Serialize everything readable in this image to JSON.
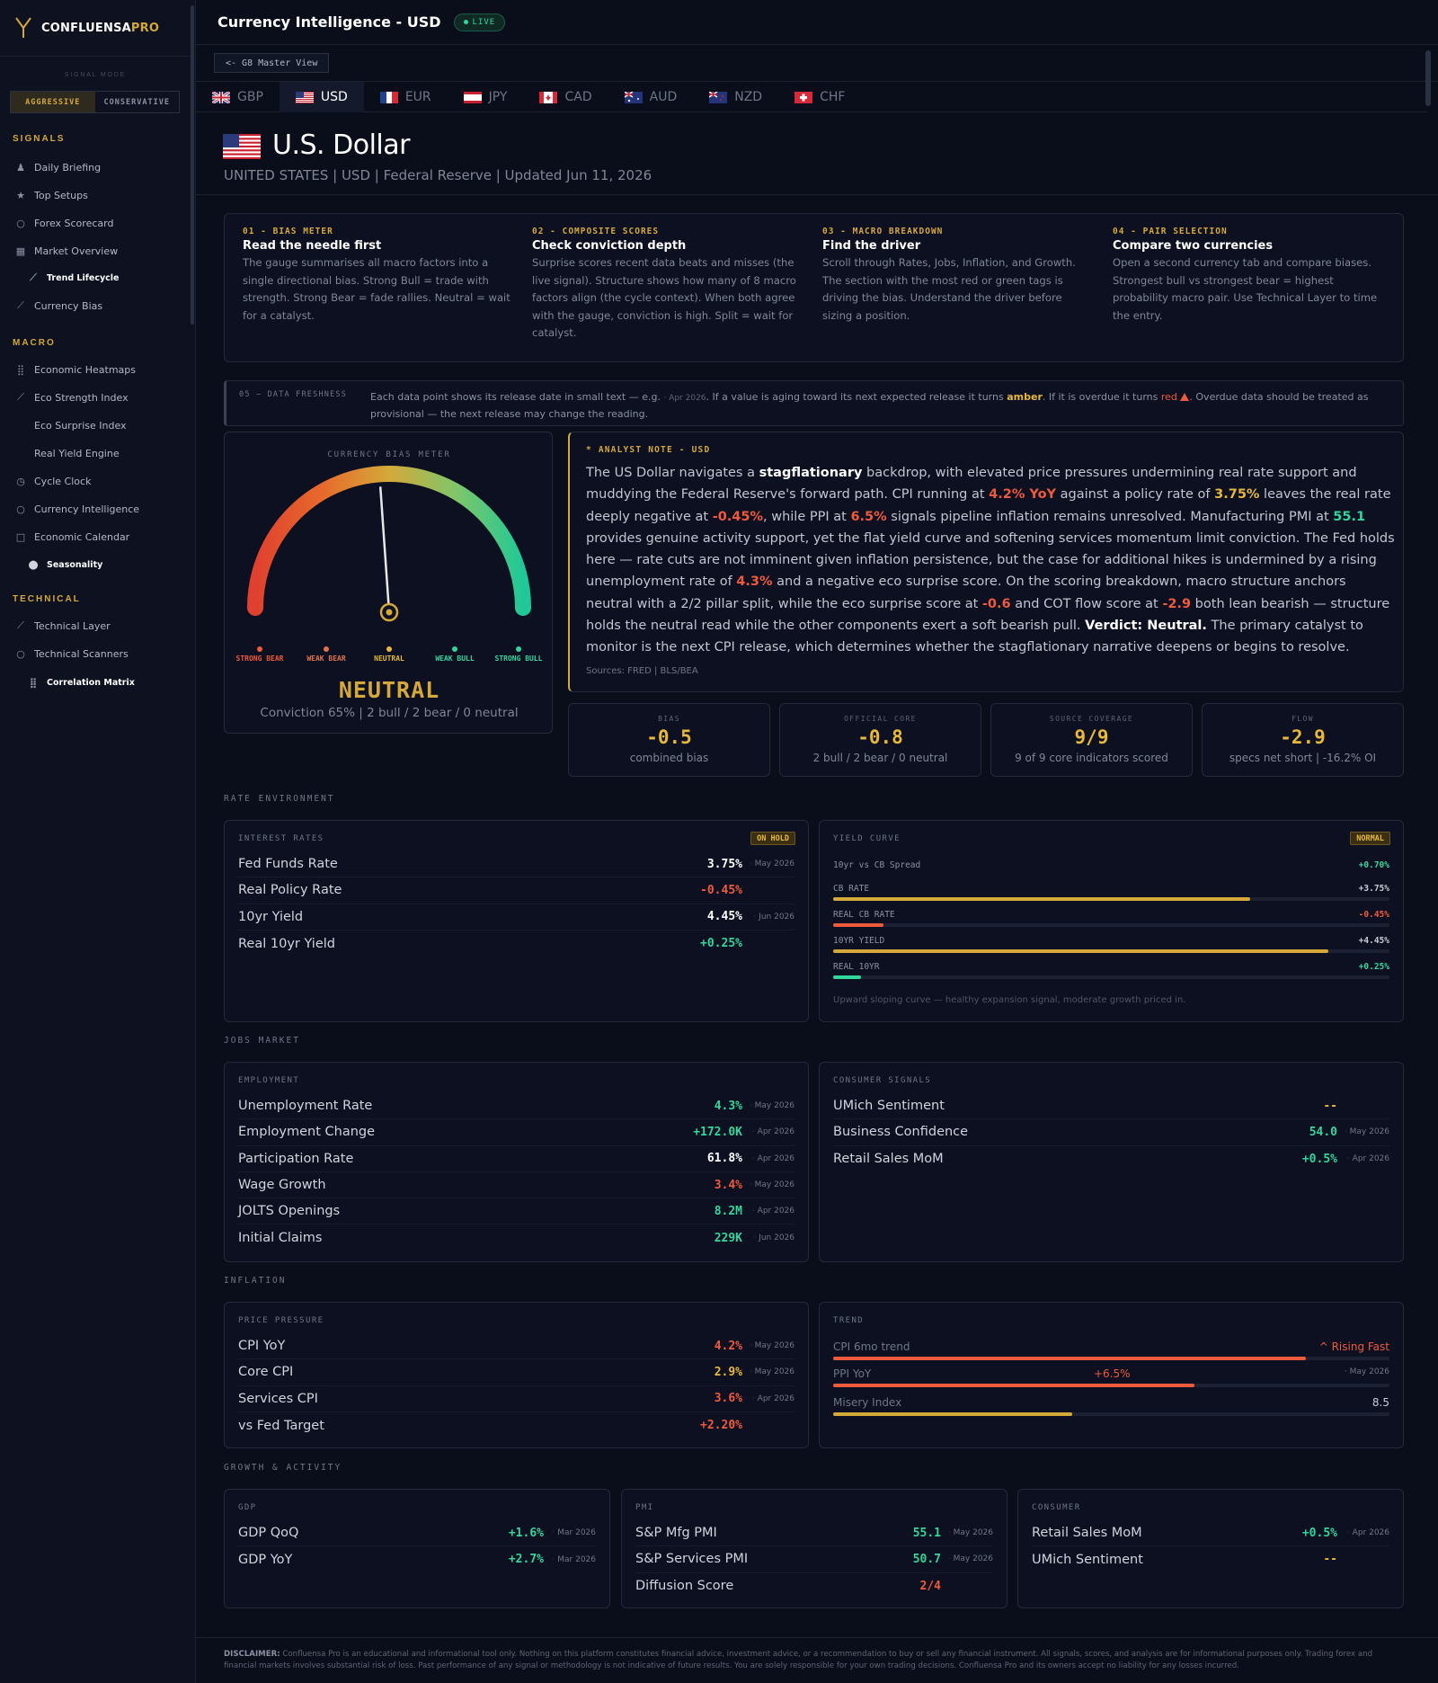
{
  "brand": {
    "name_main": "CONFLUENSA",
    "name_accent": "PRO"
  },
  "signal_mode": {
    "label": "SIGNAL MODE",
    "options": [
      "AGGRESSIVE",
      "CONSERVATIVE"
    ],
    "active": "AGGRESSIVE"
  },
  "sidebar": {
    "sections": [
      {
        "title": "SIGNALS",
        "items": [
          {
            "label": "Daily Briefing",
            "icon": "user-icon"
          },
          {
            "label": "Top Setups",
            "icon": "star-icon"
          },
          {
            "label": "Forex Scorecard",
            "icon": "circle-icon"
          },
          {
            "label": "Market Overview",
            "icon": "grid-icon"
          },
          {
            "label": "Trend Lifecycle",
            "icon": "trend-icon",
            "sub": true
          },
          {
            "label": "Currency Bias",
            "icon": "trend-icon"
          }
        ]
      },
      {
        "title": "MACRO",
        "items": [
          {
            "label": "Economic Heatmaps",
            "icon": "dots-grid-icon"
          },
          {
            "label": "Eco Strength Index",
            "icon": "trend-icon"
          },
          {
            "label": "Eco Surprise Index",
            "icon": ""
          },
          {
            "label": "Real Yield Engine",
            "icon": ""
          },
          {
            "label": "Cycle Clock",
            "icon": "clock-icon"
          },
          {
            "label": "Currency Intelligence",
            "icon": "circle-icon"
          },
          {
            "label": "Economic Calendar",
            "icon": "square-icon"
          },
          {
            "label": "Seasonality",
            "icon": "dot-icon",
            "sub": true
          }
        ]
      },
      {
        "title": "TECHNICAL",
        "items": [
          {
            "label": "Technical Layer",
            "icon": "trend-icon"
          },
          {
            "label": "Technical Scanners",
            "icon": "circle-icon"
          },
          {
            "label": "Correlation Matrix",
            "icon": "dots-grid-icon",
            "sub": true
          }
        ]
      }
    ]
  },
  "header": {
    "title": "Currency Intelligence - USD",
    "live": "LIVE",
    "back": "<- G8 Master View"
  },
  "tabs": [
    {
      "code": "GBP"
    },
    {
      "code": "USD",
      "active": true
    },
    {
      "code": "EUR"
    },
    {
      "code": "JPY"
    },
    {
      "code": "CAD"
    },
    {
      "code": "AUD"
    },
    {
      "code": "NZD"
    },
    {
      "code": "CHF"
    }
  ],
  "currency": {
    "name": "U.S. Dollar",
    "subtitle": "UNITED STATES | USD | Federal Reserve | Updated Jun 11, 2026"
  },
  "guide": [
    {
      "step": "01 - BIAS METER",
      "title": "Read the needle first",
      "body": "The gauge summarises all macro factors into a single directional bias. Strong Bull = trade with strength. Strong Bear = fade rallies. Neutral = wait for a catalyst."
    },
    {
      "step": "02 - COMPOSITE SCORES",
      "title": "Check conviction depth",
      "body": "Surprise scores recent data beats and misses (the live signal). Structure shows how many of 8 macro factors align (the cycle context). When both agree with the gauge, conviction is high. Split = wait for catalyst."
    },
    {
      "step": "03 - MACRO BREAKDOWN",
      "title": "Find the driver",
      "body": "Scroll through Rates, Jobs, Inflation, and Growth. The section with the most red or green tags is driving the bias. Understand the driver before sizing a position."
    },
    {
      "step": "04 - PAIR SELECTION",
      "title": "Compare two currencies",
      "body": "Open a second currency tab and compare biases. Strongest bull vs strongest bear = highest probability macro pair. Use Technical Layer to time the entry."
    }
  ],
  "freshness": {
    "label": "05 — DATA FRESHNESS",
    "t1": "Each data point shows its release date in small text — e.g. ",
    "example": "· Apr 2026",
    "t2": ". If a value is aging toward its next expected release it turns ",
    "amber": "amber",
    "t3": ". If it is overdue it turns ",
    "red": "red",
    "t4": ". Overdue data should be treated as provisional — the next release may change the reading."
  },
  "gauge": {
    "label": "CURRENCY BIAS METER",
    "value": 0.0,
    "zones": [
      {
        "label": "STRONG BEAR",
        "color": "#ef5a3c"
      },
      {
        "label": "WEAK BEAR",
        "color": "#e0734f"
      },
      {
        "label": "NEUTRAL",
        "color": "#e8b83a"
      },
      {
        "label": "WEAK BULL",
        "color": "#33d69a"
      },
      {
        "label": "STRONG BULL",
        "color": "#33d69a"
      }
    ],
    "verdict": "NEUTRAL",
    "conviction": "Conviction 65% | 2 bull / 2 bear / 0 neutral"
  },
  "analyst": {
    "label": "* ANALYST NOTE - USD",
    "sources": "Sources: FRED | BLS/BEA",
    "s": [
      "The US Dollar navigates a ",
      "stagflationary",
      " backdrop, with elevated price pressures undermining real rate support and muddying the Federal Reserve's forward path. CPI running at ",
      "4.2% YoY",
      " against a policy rate of ",
      "3.75%",
      " leaves the real rate deeply negative at ",
      "-0.45%",
      ", while PPI at ",
      "6.5%",
      " signals pipeline inflation remains unresolved. Manufacturing PMI at ",
      "55.1",
      " provides genuine activity support, yet the flat yield curve and softening services momentum limit conviction. The Fed holds here — rate cuts are not imminent given inflation persistence, but the case for additional hikes is undermined by a rising unemployment rate of ",
      "4.3%",
      " and a negative eco surprise score. On the scoring breakdown, macro structure anchors neutral with a 2/2 pillar split, while the eco surprise score at ",
      "-0.6",
      " and COT flow score at ",
      "-2.9",
      " both lean bearish — structure holds the neutral read while the other components exert a soft bearish pull. ",
      "Verdict: Neutral.",
      " The primary catalyst to monitor is the next CPI release, which determines whether the stagflationary narrative deepens or begins to resolve."
    ]
  },
  "stats": [
    {
      "label": "BIAS",
      "value": "-0.5",
      "sub": "combined bias"
    },
    {
      "label": "OFFICIAL CORE",
      "value": "-0.8",
      "sub": "2 bull / 2 bear / 0 neutral"
    },
    {
      "label": "SOURCE COVERAGE",
      "value": "9/9",
      "sub": "9 of 9 core indicators scored"
    },
    {
      "label": "FLOW",
      "value": "-2.9",
      "sub": "specs net short | -16.2% OI"
    }
  ],
  "sections": {
    "rate": "RATE ENVIRONMENT",
    "jobs": "JOBS MARKET",
    "inflation": "INFLATION",
    "growth": "GROWTH & ACTIVITY"
  },
  "interest_rates": {
    "title": "INTEREST RATES",
    "badge": "ON HOLD",
    "rows": [
      {
        "label": "Fed Funds Rate",
        "value": "3.75%",
        "date": "May 2026",
        "color": "w"
      },
      {
        "label": "Real Policy Rate",
        "value": "-0.45%",
        "date": "",
        "color": "r"
      },
      {
        "label": "10yr Yield",
        "value": "4.45%",
        "date": "Jun 2026",
        "color": "w"
      },
      {
        "label": "Real 10yr Yield",
        "value": "+0.25%",
        "date": "",
        "color": "g"
      }
    ]
  },
  "yield_curve": {
    "title": "YIELD CURVE",
    "badge": "NORMAL",
    "spread_label": "10yr vs CB Spread",
    "spread_value": "+0.70%",
    "bars": [
      {
        "label": "CB RATE",
        "value": "+3.75%",
        "pct": 75,
        "color": "#d4a93a",
        "vcolor": "#c8ccd6"
      },
      {
        "label": "REAL CB RATE",
        "value": "-0.45%",
        "pct": 9,
        "color": "#ef5a3c",
        "vcolor": "#ef5a3c"
      },
      {
        "label": "10YR YIELD",
        "value": "+4.45%",
        "pct": 89,
        "color": "#d4a93a",
        "vcolor": "#c8ccd6"
      },
      {
        "label": "REAL 10YR",
        "value": "+0.25%",
        "pct": 5,
        "color": "#33d69a",
        "vcolor": "#33d69a"
      }
    ],
    "note": "Upward sloping curve — healthy expansion signal, moderate growth priced in."
  },
  "employment": {
    "title": "EMPLOYMENT",
    "rows": [
      {
        "label": "Unemployment Rate",
        "value": "4.3%",
        "date": "May 2026",
        "color": "g"
      },
      {
        "label": "Employment Change",
        "value": "+172.0K",
        "date": "Apr 2026",
        "color": "g"
      },
      {
        "label": "Participation Rate",
        "value": "61.8%",
        "date": "Apr 2026",
        "color": "w"
      },
      {
        "label": "Wage Growth",
        "value": "3.4%",
        "date": "May 2026",
        "color": "r"
      },
      {
        "label": "JOLTS Openings",
        "value": "8.2M",
        "date": "Apr 2026",
        "color": "g"
      },
      {
        "label": "Initial Claims",
        "value": "229K",
        "date": "Jun 2026",
        "color": "g"
      }
    ]
  },
  "consumer_signals": {
    "title": "CONSUMER SIGNALS",
    "rows": [
      {
        "label": "UMich Sentiment",
        "value": "--",
        "date": "",
        "color": "y"
      },
      {
        "label": "Business Confidence",
        "value": "54.0",
        "date": "May 2026",
        "color": "g"
      },
      {
        "label": "Retail Sales MoM",
        "value": "+0.5%",
        "date": "Apr 2026",
        "color": "g"
      }
    ]
  },
  "price_pressure": {
    "title": "PRICE PRESSURE",
    "rows": [
      {
        "label": "CPI YoY",
        "value": "4.2%",
        "date": "May 2026",
        "color": "r"
      },
      {
        "label": "Core CPI",
        "value": "2.9%",
        "date": "May 2026",
        "color": "y"
      },
      {
        "label": "Services CPI",
        "value": "3.6%",
        "date": "Apr 2026",
        "color": "r"
      },
      {
        "label": "vs Fed Target",
        "value": "+2.20%",
        "date": "",
        "color": "r"
      }
    ]
  },
  "trend": {
    "title": "TREND",
    "items": [
      {
        "label": "CPI 6mo trend",
        "value": "^ Rising Fast",
        "mid": "",
        "date": "",
        "pct": 85,
        "color": "#ef5a3c",
        "vcolor": "#ef5a3c"
      },
      {
        "label": "PPI YoY",
        "value": "",
        "mid": "+6.5%",
        "date": "· May 2026",
        "pct": 65,
        "color": "#ef5a3c",
        "vcolor": "#ef5a3c"
      },
      {
        "label": "Misery Index",
        "value": "8.5",
        "mid": "",
        "date": "",
        "pct": 43,
        "color": "#d4a93a",
        "vcolor": "#c8ccd6"
      }
    ]
  },
  "gdp": {
    "title": "GDP",
    "rows": [
      {
        "label": "GDP QoQ",
        "value": "+1.6%",
        "date": "Mar 2026",
        "color": "g"
      },
      {
        "label": "GDP YoY",
        "value": "+2.7%",
        "date": "Mar 2026",
        "color": "g"
      }
    ]
  },
  "pmi": {
    "title": "PMI",
    "rows": [
      {
        "label": "S&P Mfg PMI",
        "value": "55.1",
        "date": "May 2026",
        "color": "g"
      },
      {
        "label": "S&P Services PMI",
        "value": "50.7",
        "date": "May 2026",
        "color": "g"
      },
      {
        "label": "Diffusion Score",
        "value": "2/4",
        "date": "",
        "color": "r"
      }
    ]
  },
  "consumer": {
    "title": "CONSUMER",
    "rows": [
      {
        "label": "Retail Sales MoM",
        "value": "+0.5%",
        "date": "Apr 2026",
        "color": "g"
      },
      {
        "label": "UMich Sentiment",
        "value": "--",
        "date": "",
        "color": "y"
      }
    ]
  },
  "disclaimer": {
    "label": "DISCLAIMER:",
    "text": " Confluensa Pro is an educational and informational tool only. Nothing on this platform constitutes financial advice, investment advice, or a recommendation to buy or sell any financial instrument. All signals, scores, and analysis are for informational purposes only. Trading forex and financial markets involves substantial risk of loss. Past performance of any signal or methodology is not indicative of future results. You are solely responsible for your own trading decisions. Confluensa Pro and its owners accept no liability for any losses incurred."
  }
}
